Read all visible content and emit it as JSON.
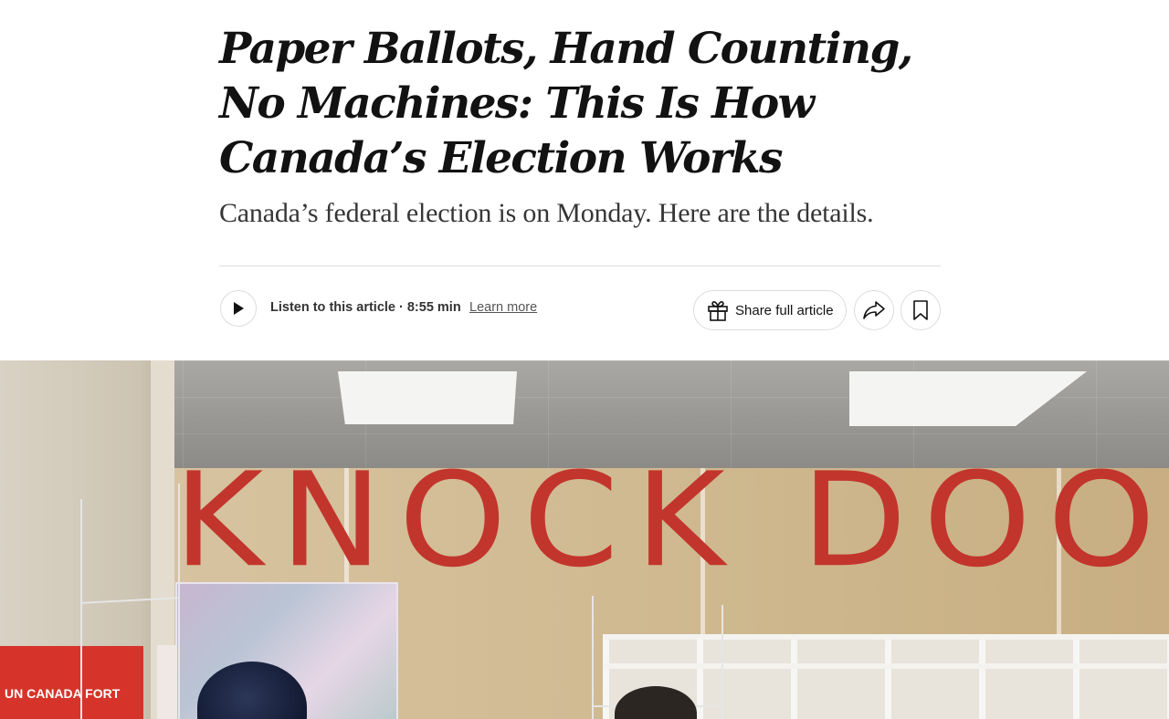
{
  "article": {
    "headline": "Paper Ballots, Hand Counting, No Machines: This Is How Canada’s Election Works",
    "summary": "Canada’s federal election is on Monday. Here are the details."
  },
  "toolbar": {
    "play_icon": "play-icon",
    "listen_label": "Listen to this article · 8:55 min",
    "learn_more": "Learn more",
    "share_full_label": "Share full article",
    "gift_icon": "gift-icon",
    "share_icon": "share-arrow-icon",
    "save_icon": "bookmark-icon"
  },
  "hero_image": {
    "banner_text": "KNOCK DOOR",
    "sign_text": "UN CANADA FORT",
    "accent_color": "#c2352c"
  }
}
